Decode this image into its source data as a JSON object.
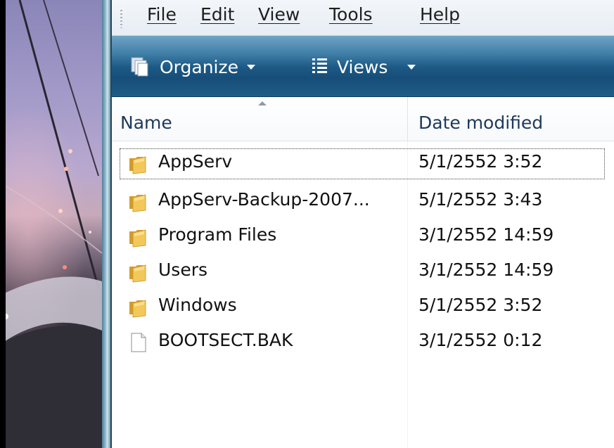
{
  "menubar": {
    "items": [
      {
        "label": "File"
      },
      {
        "label": "Edit"
      },
      {
        "label": "View"
      },
      {
        "label": "Tools"
      },
      {
        "label": "Help"
      }
    ]
  },
  "commandbar": {
    "organize_label": "Organize",
    "views_label": "Views"
  },
  "columns": {
    "name": "Name",
    "date_modified": "Date modified"
  },
  "files": [
    {
      "name": "AppServ",
      "date": "5/1/2552 3:52",
      "icon": "folder-icon",
      "focused": true
    },
    {
      "name": "AppServ-Backup-2007...",
      "date": "5/1/2552 3:43",
      "icon": "folder-icon"
    },
    {
      "name": "Program Files",
      "date": "3/1/2552 14:59",
      "icon": "folder-icon"
    },
    {
      "name": "Users",
      "date": "3/1/2552 14:59",
      "icon": "folder-icon"
    },
    {
      "name": "Windows",
      "date": "5/1/2552 3:52",
      "icon": "folder-icon"
    },
    {
      "name": "BOOTSECT.BAK",
      "date": "3/1/2552 0:12",
      "icon": "file-icon"
    }
  ],
  "colors": {
    "command_bar": "#1d5985",
    "header_text": "#1e395b",
    "folder": "#e8b94a"
  }
}
